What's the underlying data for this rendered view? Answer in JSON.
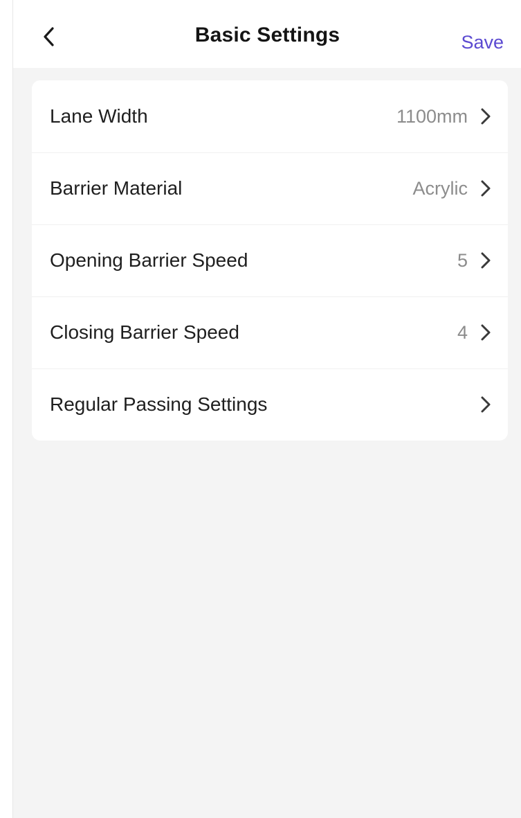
{
  "header": {
    "title": "Basic Settings",
    "save_label": "Save",
    "back_icon": "chevron-left-icon"
  },
  "settings": {
    "items": [
      {
        "label": "Lane Width",
        "value": "1100mm",
        "icon": "chevron-right-icon"
      },
      {
        "label": "Barrier Material",
        "value": "Acrylic",
        "icon": "chevron-right-icon"
      },
      {
        "label": "Opening Barrier Speed",
        "value": "5",
        "icon": "chevron-right-icon"
      },
      {
        "label": "Closing Barrier Speed",
        "value": "4",
        "icon": "chevron-right-icon"
      },
      {
        "label": "Regular Passing Settings",
        "value": "",
        "icon": "chevron-right-icon"
      }
    ]
  },
  "colors": {
    "accent": "#5b4ad1",
    "background": "#f4f4f4",
    "card": "#ffffff",
    "value_text": "#8c8c8c"
  }
}
